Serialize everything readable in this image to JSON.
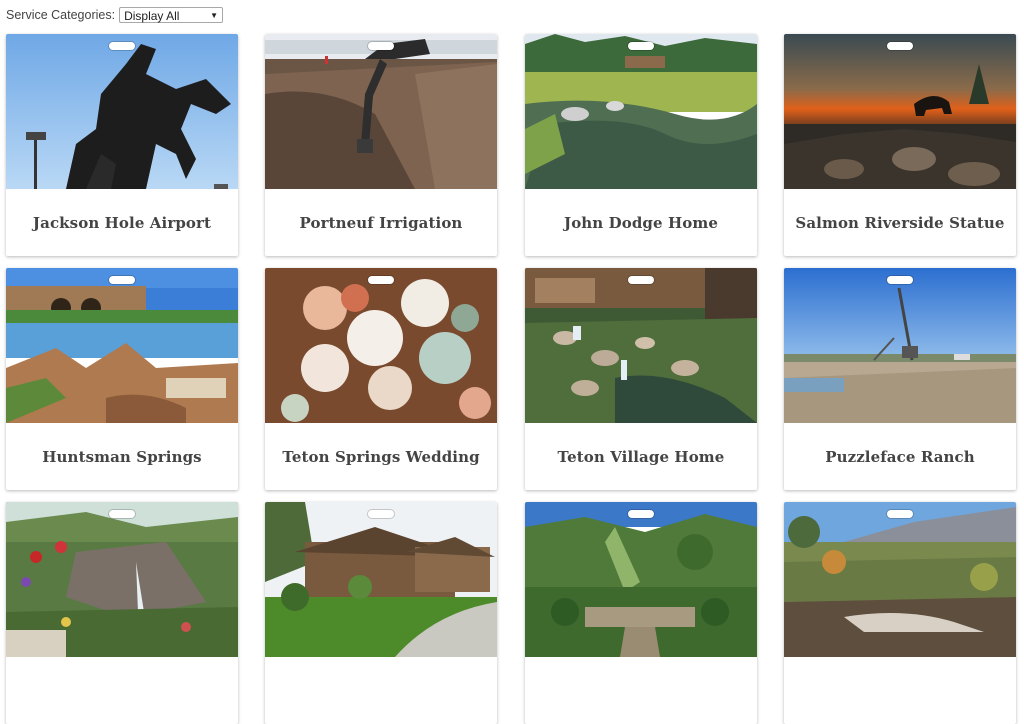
{
  "filter": {
    "label": "Service Categories:",
    "selected": "Display All"
  },
  "cards": [
    {
      "title": "Jackson Hole Airport"
    },
    {
      "title": "Portneuf Irrigation"
    },
    {
      "title": "John Dodge Home"
    },
    {
      "title": "Salmon Riverside Statue"
    },
    {
      "title": "Huntsman Springs"
    },
    {
      "title": "Teton Springs Wedding"
    },
    {
      "title": "Teton Village Home"
    },
    {
      "title": "Puzzleface Ranch"
    },
    {
      "title": ""
    },
    {
      "title": ""
    },
    {
      "title": ""
    },
    {
      "title": ""
    }
  ]
}
